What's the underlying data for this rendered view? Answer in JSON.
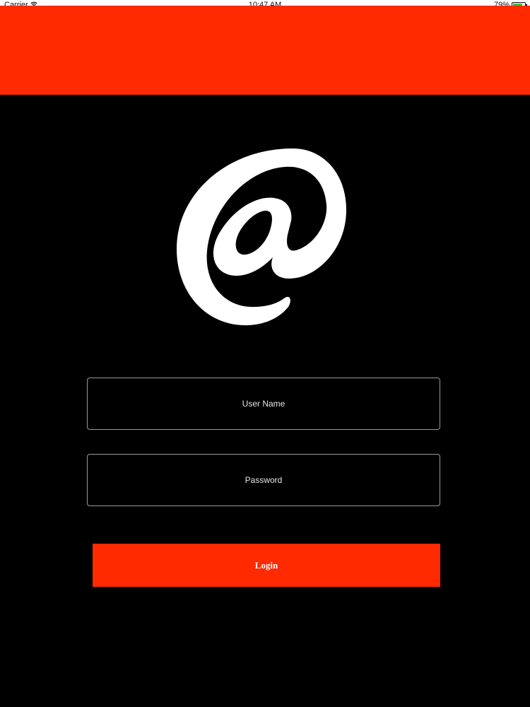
{
  "status_bar": {
    "carrier": "Carrier",
    "time": "10:47 AM",
    "battery": "79%",
    "battery_level": 0.79
  },
  "colors": {
    "accent": "#ff2a00",
    "background": "#000000",
    "field_border": "#9a9a9a",
    "text": "#ffffff"
  },
  "logo": {
    "icon": "at-sign-icon"
  },
  "form": {
    "username_placeholder": "User Name",
    "username_value": "",
    "password_placeholder": "Password",
    "password_value": "",
    "login_label": "Login"
  }
}
